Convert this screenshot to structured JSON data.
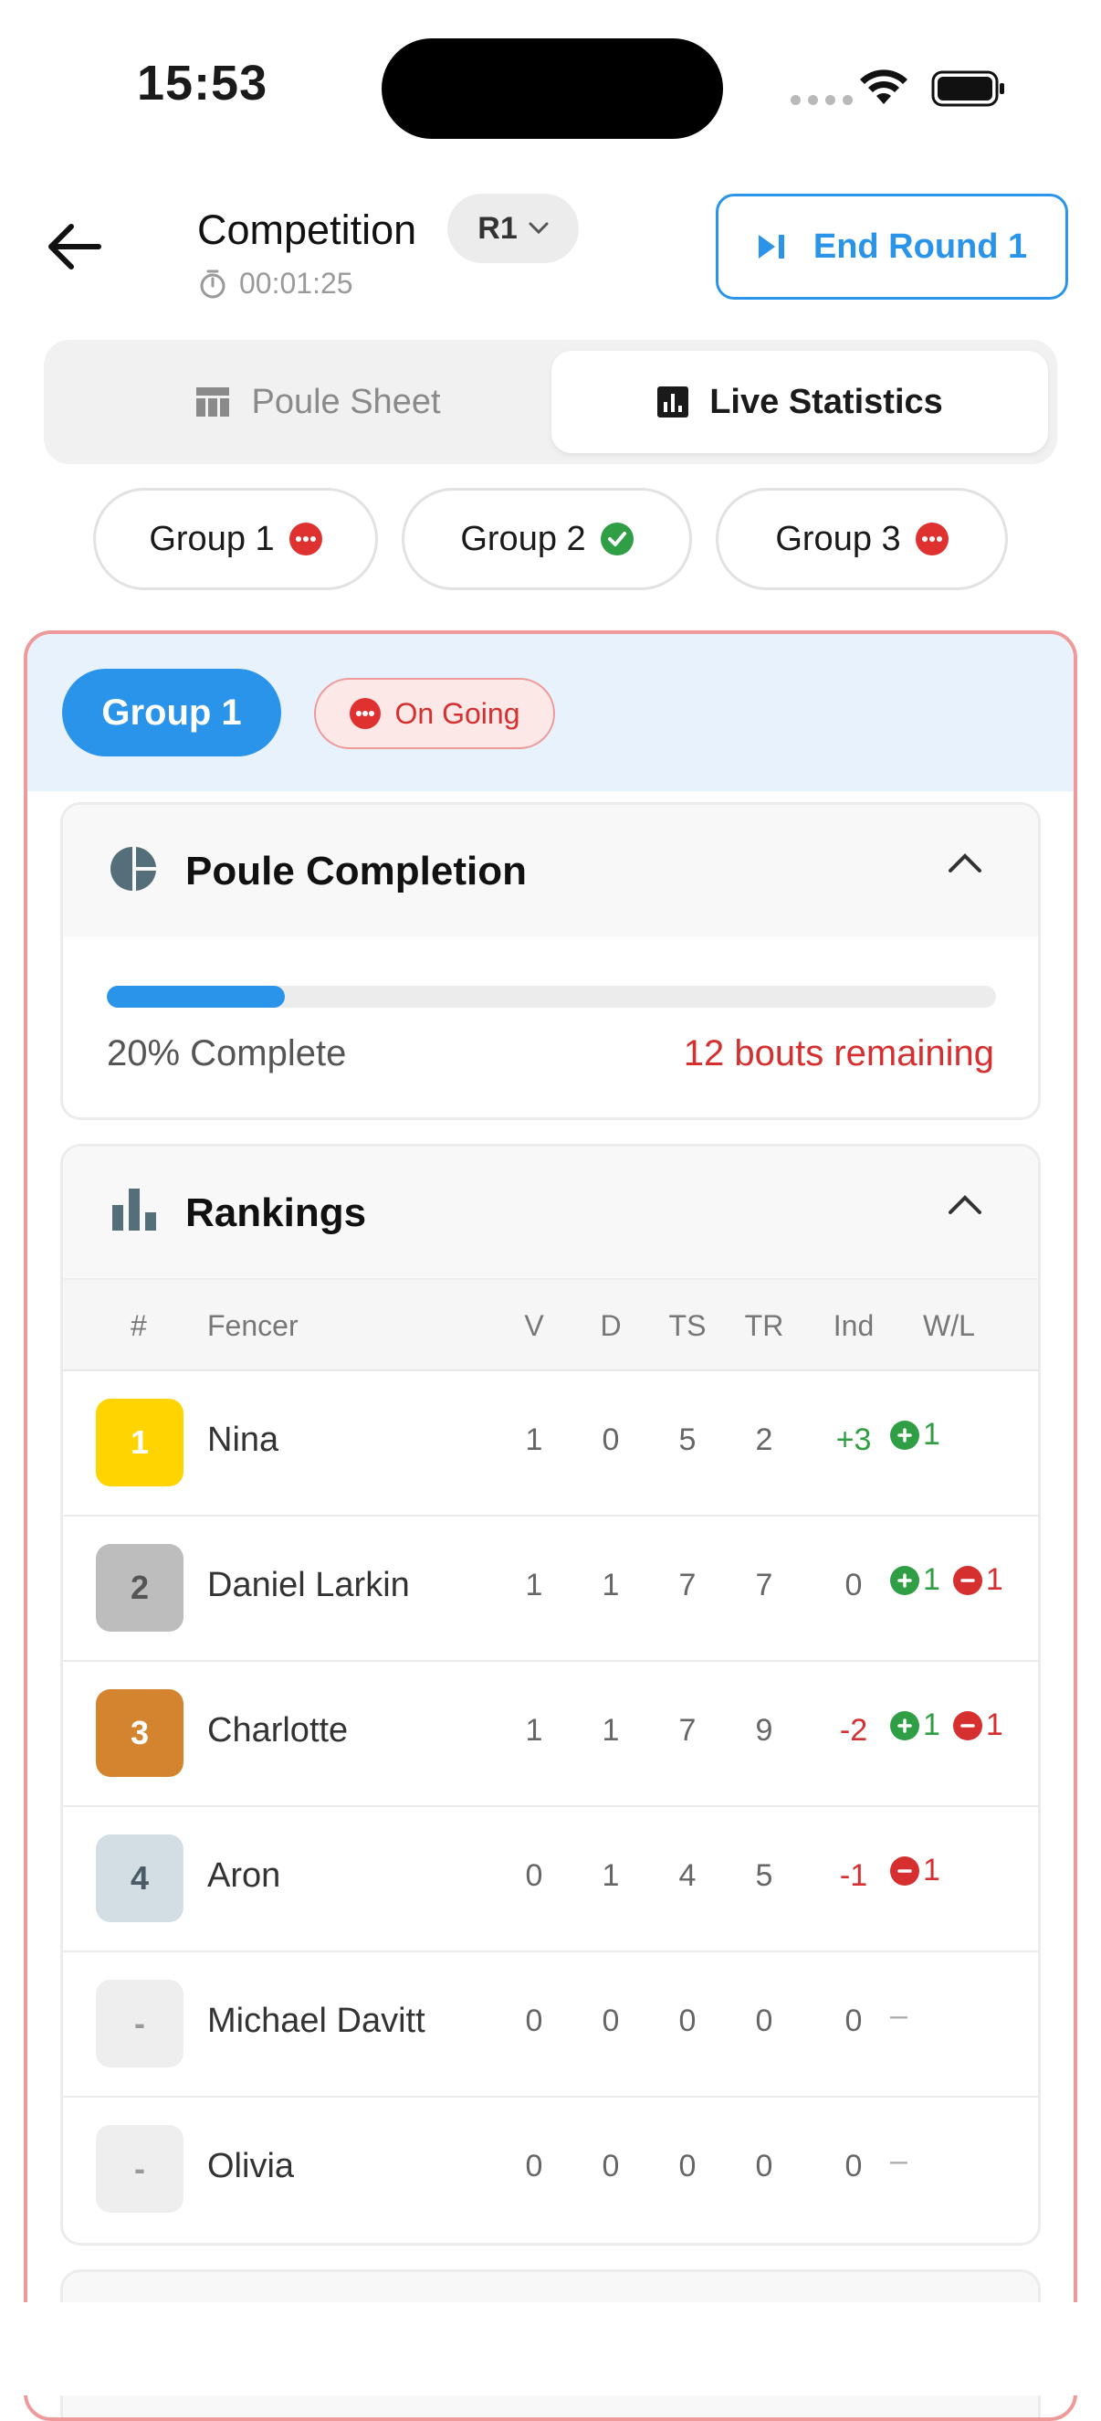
{
  "status_bar": {
    "time": "15:53"
  },
  "header": {
    "title": "Competition",
    "round_selector": "R1",
    "timer": "00:01:25",
    "end_round_label": "End Round 1"
  },
  "tabs": {
    "poule_sheet": "Poule Sheet",
    "live_statistics": "Live Statistics",
    "active": "Live Statistics"
  },
  "groups": [
    {
      "label": "Group 1",
      "status": "ongoing"
    },
    {
      "label": "Group 2",
      "status": "complete"
    },
    {
      "label": "Group 3",
      "status": "ongoing"
    }
  ],
  "card": {
    "group_label": "Group 1",
    "status_label": "On Going",
    "completion": {
      "title": "Poule Completion",
      "percent": 20,
      "percent_label": "20% Complete",
      "remaining_label": "12 bouts remaining"
    },
    "rankings": {
      "title": "Rankings",
      "columns": {
        "rank": "#",
        "fencer": "Fencer",
        "v": "V",
        "d": "D",
        "ts": "TS",
        "tr": "TR",
        "ind": "Ind",
        "wl": "W/L"
      },
      "rows": [
        {
          "rank": "1",
          "name": "Nina",
          "v": "1",
          "d": "0",
          "ts": "5",
          "tr": "2",
          "ind": "+3",
          "wins": "1",
          "losses": ""
        },
        {
          "rank": "2",
          "name": "Daniel Larkin",
          "v": "1",
          "d": "1",
          "ts": "7",
          "tr": "7",
          "ind": "0",
          "wins": "1",
          "losses": "1"
        },
        {
          "rank": "3",
          "name": "Charlotte",
          "v": "1",
          "d": "1",
          "ts": "7",
          "tr": "9",
          "ind": "-2",
          "wins": "1",
          "losses": "1"
        },
        {
          "rank": "4",
          "name": "Aron",
          "v": "0",
          "d": "1",
          "ts": "4",
          "tr": "5",
          "ind": "-1",
          "wins": "",
          "losses": "1"
        },
        {
          "rank": "-",
          "name": "Michael Davitt",
          "v": "0",
          "d": "0",
          "ts": "0",
          "tr": "0",
          "ind": "0",
          "wins": "",
          "losses": ""
        },
        {
          "rank": "-",
          "name": "Olivia",
          "v": "0",
          "d": "0",
          "ts": "0",
          "tr": "0",
          "ind": "0",
          "wins": "",
          "losses": ""
        }
      ],
      "wl_empty": "–"
    }
  },
  "colors": {
    "accent": "#2a93ea",
    "danger": "#d62f2f",
    "success": "#2f9e44",
    "gold": "#ffd400",
    "silver": "#bdbdbd",
    "bronze": "#d4832f",
    "fourth": "#d3dde4"
  },
  "icons": [
    "back-arrow-icon",
    "chevron-down-icon",
    "timer-icon",
    "skip-next-icon",
    "table-icon",
    "bar-chart-icon",
    "more-dots-icon",
    "check-circle-icon",
    "pie-chart-icon",
    "chevron-up-icon",
    "plus-circle-icon",
    "minus-circle-icon",
    "wifi-icon",
    "battery-icon"
  ]
}
